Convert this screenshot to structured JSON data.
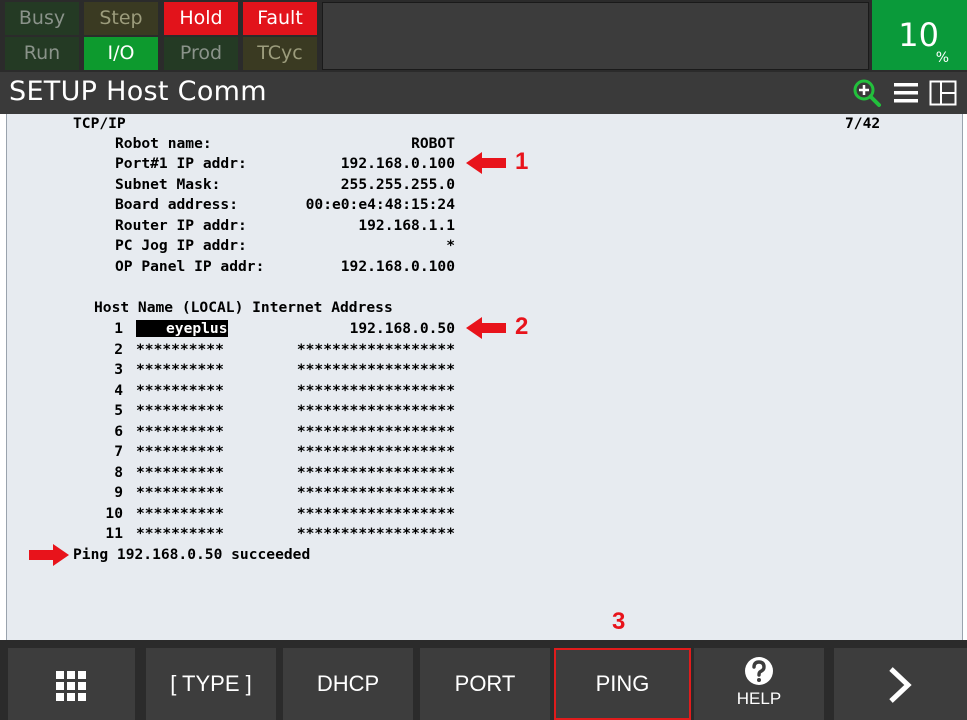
{
  "status": {
    "row1": [
      "Busy",
      "Step",
      "Hold",
      "Fault"
    ],
    "row2": [
      "Run",
      "I/O",
      "Prod",
      "TCyc"
    ],
    "override_value": "10",
    "override_unit": "%"
  },
  "title": "SETUP Host Comm",
  "section": "TCP/IP",
  "page_indicator": "7/42",
  "fields": [
    {
      "label": "Robot name:",
      "value": "ROBOT"
    },
    {
      "label": "Port#1 IP addr:",
      "value": "192.168.0.100"
    },
    {
      "label": "Subnet Mask:",
      "value": "255.255.255.0"
    },
    {
      "label": "Board address:",
      "value": "00:e0:e4:48:15:24"
    },
    {
      "label": "Router IP addr:",
      "value": "192.168.1.1"
    },
    {
      "label": "PC Jog IP addr:",
      "value": "*"
    },
    {
      "label": "OP Panel IP addr:",
      "value": "192.168.0.100"
    }
  ],
  "host_header": "Host Name (LOCAL) Internet Address",
  "hosts": [
    {
      "num": "1",
      "name": "eyeplus",
      "addr": "192.168.0.50"
    },
    {
      "num": "2",
      "name": "**********",
      "addr": "******************"
    },
    {
      "num": "3",
      "name": "**********",
      "addr": "******************"
    },
    {
      "num": "4",
      "name": "**********",
      "addr": "******************"
    },
    {
      "num": "5",
      "name": "**********",
      "addr": "******************"
    },
    {
      "num": "6",
      "name": "**********",
      "addr": "******************"
    },
    {
      "num": "7",
      "name": "**********",
      "addr": "******************"
    },
    {
      "num": "8",
      "name": "**********",
      "addr": "******************"
    },
    {
      "num": "9",
      "name": "**********",
      "addr": "******************"
    },
    {
      "num": "10",
      "name": "**********",
      "addr": "******************"
    },
    {
      "num": "11",
      "name": "**********",
      "addr": "******************"
    }
  ],
  "message": "Ping 192.168.0.50 succeeded",
  "annotations": {
    "one": "1",
    "two": "2",
    "three": "3"
  },
  "softkeys": {
    "type": "[ TYPE ]",
    "dhcp": "DHCP",
    "port": "PORT",
    "ping": "PING",
    "help": "HELP"
  },
  "icons": {
    "zoom": "zoom-in-icon",
    "menu": "menu-icon",
    "layout": "split-layout-icon",
    "grid": "grid-icon",
    "help": "question-mark-icon",
    "next": "chevron-right-icon"
  },
  "colors": {
    "hold_fault": "#e2131b",
    "io_active": "#0d9a2e",
    "override_bg": "#0a9a3a",
    "annotation": "#e8131b",
    "screen_bg": "#e7ebf0"
  }
}
